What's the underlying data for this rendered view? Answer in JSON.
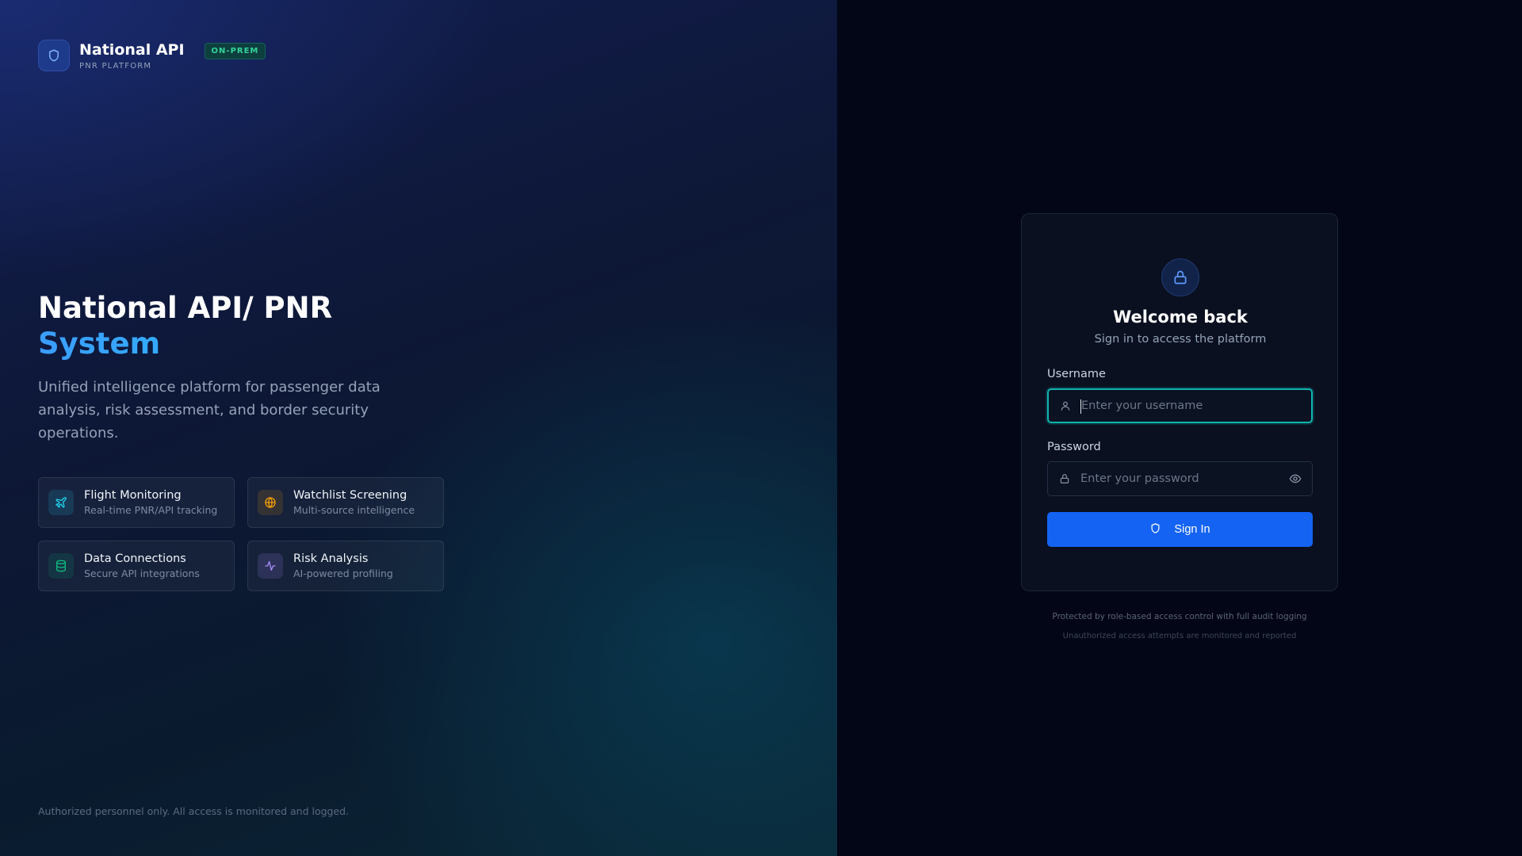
{
  "brand": {
    "name": "National API",
    "subtitle": "PNR PLATFORM",
    "badge": "ON-PREM",
    "logo_icon": "shield-icon"
  },
  "hero": {
    "title_line1": "National API/ PNR",
    "title_line2": "System",
    "description": "Unified intelligence platform for passenger data analysis, risk assessment, and border security operations."
  },
  "features": [
    {
      "title": "Flight Monitoring",
      "subtitle": "Real-time PNR/API tracking",
      "icon": "plane-icon",
      "color": "#22d3ee"
    },
    {
      "title": "Watchlist Screening",
      "subtitle": "Multi-source intelligence",
      "icon": "globe-icon",
      "color": "#f59e0b"
    },
    {
      "title": "Data Connections",
      "subtitle": "Secure API integrations",
      "icon": "database-icon",
      "color": "#10b981"
    },
    {
      "title": "Risk Analysis",
      "subtitle": "AI-powered profiling",
      "icon": "activity-icon",
      "color": "#a78bfa"
    }
  ],
  "left_footer": "Authorized personnel only. All access is monitored and logged.",
  "login": {
    "title": "Welcome back",
    "subtitle": "Sign in to access the platform",
    "username_label": "Username",
    "username_placeholder": "Enter your username",
    "password_label": "Password",
    "password_placeholder": "Enter your password",
    "signin_label": "Sign In",
    "footer_line1": "Protected by role-based access control with full audit logging",
    "footer_line2": "Unauthorized access attempts are monitored and reported"
  },
  "colors": {
    "accent": "#1463f3",
    "focus_ring": "#0fb5b0",
    "badge_text": "#34d399"
  }
}
